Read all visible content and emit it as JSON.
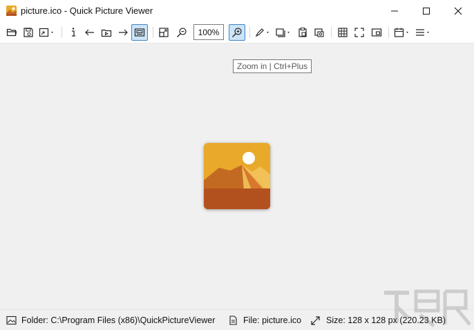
{
  "window": {
    "title": "picture.ico - Quick Picture Viewer",
    "controls": [
      "minimize-icon",
      "maximize-icon",
      "close-icon"
    ]
  },
  "toolbar": {
    "zoom_value": "100%",
    "icons": [
      "open-folder-icon",
      "save-icon",
      "export-image-icon",
      "info-icon",
      "arrow-left-icon",
      "slideshow-icon",
      "arrow-right-icon",
      "fullscreen-viewer-icon",
      "zoom-fit-icon",
      "zoom-out-icon",
      "zoom-in-icon",
      "draw-icon",
      "crop-icon",
      "paste-icon",
      "screenshot-icon",
      "grid-icon",
      "expand-icon",
      "picture-in-picture-icon",
      "calendar-icon",
      "menu-icon"
    ],
    "active": "zoom-in-icon"
  },
  "tooltip": {
    "text": "Zoom in | Ctrl+Plus"
  },
  "status": {
    "folder": "Folder: C:\\Program Files (x86)\\QuickPictureViewer",
    "file": "File: picture.ico",
    "size": "Size: 128 x 128 px (220.23 KB)"
  },
  "colors": {
    "accent": "#3c84c4",
    "active_bg": "#cce4f7",
    "canvas_bg": "#f0f0f0",
    "picture_sky": "#e9a92b",
    "picture_sun": "#ffffff",
    "picture_mountain": "#c36a22",
    "picture_ground": "#b3511e"
  }
}
